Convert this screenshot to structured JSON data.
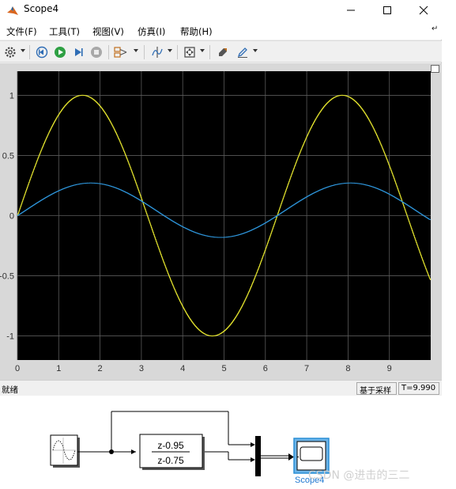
{
  "window": {
    "title": "Scope4",
    "menu": {
      "file": "文件(F)",
      "tools": "工具(T)",
      "view": "视图(V)",
      "simulation": "仿真(I)",
      "help": "帮助(H)"
    }
  },
  "toolbar": {
    "icons": [
      "settings-icon",
      "step-back-icon",
      "run-icon",
      "step-forward-icon",
      "stop-icon",
      "signal-selector-icon",
      "cursor-measure-icon",
      "zoom-fit-icon",
      "style-icon",
      "highlight-icon"
    ]
  },
  "colors": {
    "plot_background": "#000000",
    "grid": "#5a5a5a",
    "axis_text": "#e0e0e0",
    "accent_blue": "#1f78d1",
    "play_green": "#2ea043"
  },
  "chart_data": {
    "type": "line",
    "xlim": [
      0,
      10
    ],
    "ylim": [
      -1.2,
      1.2
    ],
    "xticks": [
      "0",
      "1",
      "2",
      "3",
      "4",
      "5",
      "6",
      "7",
      "8",
      "9"
    ],
    "yticks": [
      "1",
      "0.5",
      "0",
      "-0.5",
      "-1"
    ],
    "grid": true,
    "series": [
      {
        "color": "#e6e62e",
        "amplitude": 1.0,
        "frequency": 1.0,
        "phase": 0,
        "x_end": 9.99,
        "sample_step": 0.01
      },
      {
        "color": "#2e96dc",
        "amplitude": 0.226,
        "frequency": 1.0,
        "phase": -0.2,
        "x_end": 9.99,
        "sample_step": 0.01
      }
    ]
  },
  "status": {
    "text": "就绪",
    "sample_mode": "基于采样",
    "time": "T=9.990"
  },
  "diagram": {
    "transfer_numerator": "z-0.95",
    "transfer_denominator": "z-0.75",
    "scope_label": "Scope4"
  },
  "watermark": "CSDN @进击的三二"
}
